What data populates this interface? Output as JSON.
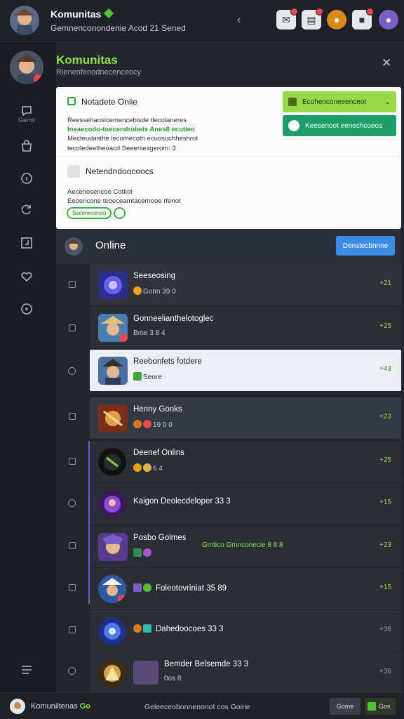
{
  "topbar": {
    "title": "Komunitas",
    "subtitle": "Gemnenconondenie Acod 21 Sened",
    "icons": [
      "notification-icon",
      "inbox-icon",
      "gold-badge-icon",
      "store-icon",
      "profile-icon"
    ]
  },
  "header": {
    "title": "Komunitas",
    "subtitle": "Rienenfenodnecenceocy"
  },
  "sidebar": {
    "items": [
      {
        "icon": "chat-bubble-icon",
        "label": "Gems"
      },
      {
        "icon": "bag-icon",
        "label": ""
      },
      {
        "icon": "circle-info-icon",
        "label": ""
      },
      {
        "icon": "refresh-icon",
        "label": ""
      },
      {
        "icon": "gallery-icon",
        "label": ""
      },
      {
        "icon": "heart-icon",
        "label": ""
      },
      {
        "icon": "play-circle-icon",
        "label": ""
      },
      {
        "icon": "menu-icon",
        "label": ""
      }
    ]
  },
  "notice": {
    "title": "Notadete Onlie",
    "lines": [
      "Reessehansicemencebisde tlecolaneres",
      "Ineaecodo-toecendrobeis Anes8 ecutieo",
      "Mecteudasthe lecomecoth ecuosuchheshrot",
      "tecoledeetheoacd Seeeniesgerom: 3"
    ],
    "green_button": "Ecohenconeeenceot",
    "teal_button": "Keesenoot eenechcoeos",
    "section2_title": "Netendndoocoocs",
    "section2_lines": [
      "Aecenosencoo Cotkol",
      "Eeoencone teoeceamtacernooe rfenot"
    ],
    "pill_label": "Secenececoo"
  },
  "online": {
    "label": "Online",
    "button": "Denstecbnnne"
  },
  "rows": [
    {
      "name": "Seeseosing",
      "meta": "Gonn 39 0",
      "value": "+21",
      "variant": "alt"
    },
    {
      "name": "Gonneelianthelotoglec",
      "meta": "Bme 3 8 4",
      "value": "+25",
      "variant": "normal"
    },
    {
      "name": "Reebonfets fotdere",
      "meta": "Seore",
      "value": "+43",
      "variant": "sel"
    },
    {
      "name": "Henny Gonks",
      "meta": "19 0 0",
      "value": "+23",
      "variant": "alt"
    },
    {
      "name": "Deenef Onlins",
      "meta": "6 4",
      "value": "+25",
      "variant": "normal"
    },
    {
      "name": "Kaigon Deolecdeloper 33 3",
      "meta": "",
      "value": "+15",
      "variant": "normal"
    },
    {
      "name": "Posbo Golmes",
      "meta": "Gmtico Gmnconecie 8 8 8",
      "value": "+23",
      "variant": "normal"
    },
    {
      "name": "Foleotovriniat 35 89",
      "meta": "",
      "value": "+15",
      "variant": "normal"
    },
    {
      "name": "Dahedoocoes 33 3",
      "meta": "",
      "value": "+36",
      "variant": "normal"
    },
    {
      "name": "Bemder Belsemde 33 3",
      "meta": "0os 8",
      "value": "+36",
      "variant": "normal"
    }
  ],
  "footer": {
    "user": "Komuniltenas",
    "user_suffix": "Go",
    "center": "Geleeceobonnenonot cos Goirie",
    "btn1": "Gome",
    "btn2": "Gos"
  },
  "colors": {
    "accent_green": "#8ee04a",
    "primary_blue": "#3d8ce6",
    "teal": "#1e9c6a",
    "lime_button": "#98d94a",
    "selection_purple": "#6e5bd6"
  }
}
